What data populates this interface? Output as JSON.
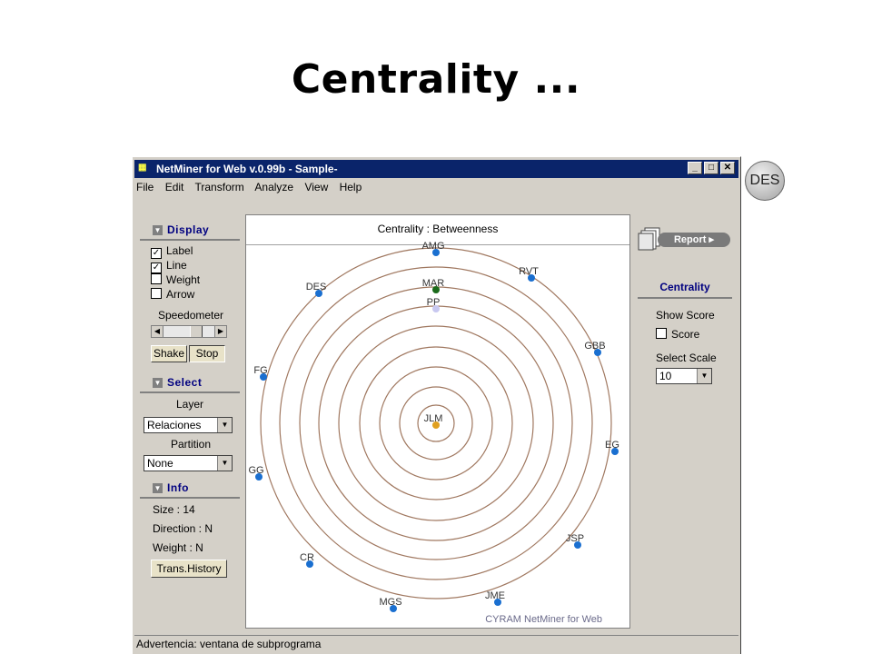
{
  "slide": {
    "title": "Centrality ..."
  },
  "badge": {
    "label": "DES"
  },
  "window": {
    "title": "NetMiner for Web v.0.99b - Sample-",
    "menu": [
      "File",
      "Edit",
      "Transform",
      "Analyze",
      "View",
      "Help"
    ],
    "status": "Advertencia: ventana de subprograma"
  },
  "display": {
    "header": "Display",
    "options": [
      {
        "label": "Label",
        "checked": true
      },
      {
        "label": "Line",
        "checked": true
      },
      {
        "label": "Weight",
        "checked": false
      },
      {
        "label": "Arrow",
        "checked": false
      }
    ],
    "speedometer": "Speedometer",
    "shake": "Shake",
    "stop": "Stop"
  },
  "select": {
    "header": "Select",
    "layer_label": "Layer",
    "layer_value": "Relaciones",
    "partition_label": "Partition",
    "partition_value": "None"
  },
  "info": {
    "header": "Info",
    "size": "Size : 14",
    "direction": "Direction : N",
    "weight": "Weight : N",
    "trans_history": "Trans.History"
  },
  "graph": {
    "title": "Centrality : Betweenness",
    "watermark": "CYRAM NetMiner for Web",
    "nodes": [
      "AMG",
      "RVT",
      "MAR",
      "DES",
      "PP",
      "GBB",
      "FG",
      "JLM",
      "EG",
      "GG",
      "JSP",
      "CR",
      "JME",
      "MGS"
    ]
  },
  "right": {
    "report": "Report",
    "section": "Centrality",
    "show_score": "Show Score",
    "score": "Score",
    "select_scale": "Select Scale",
    "scale_value": "10"
  },
  "colors": {
    "node_blue": "#1a6fd0",
    "node_orange": "#e0a020",
    "node_green": "#1a6a1a",
    "node_lavender": "#c8c8f0",
    "ring": "#a07860"
  }
}
